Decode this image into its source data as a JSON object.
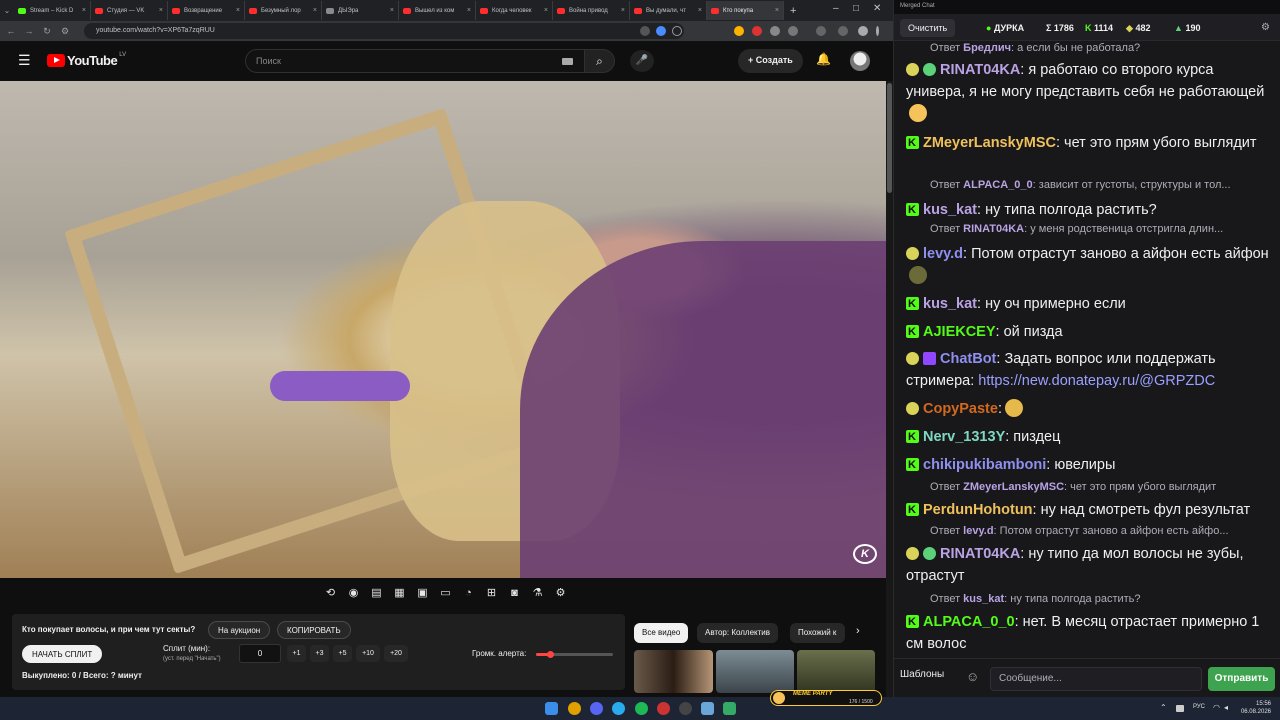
{
  "tabs": [
    {
      "label": "Stream – Kick D",
      "color": "#53fc18"
    },
    {
      "label": "Студия — VK",
      "color": "#ff2d2d"
    },
    {
      "label": "Возвращение",
      "color": "#ff2d2d"
    },
    {
      "label": "Безумный лор",
      "color": "#ff2d2d"
    },
    {
      "label": "ДЫЭра",
      "color": "#8a8a8a"
    },
    {
      "label": "Вышел из ком",
      "color": "#ff2d2d"
    },
    {
      "label": "Когда человек",
      "color": "#ff2d2d"
    },
    {
      "label": "Война привод",
      "color": "#ff2d2d"
    },
    {
      "label": "Вы думали, чт",
      "color": "#ff2d2d"
    },
    {
      "label": "Кто покупа",
      "color": "#ff2d2d",
      "active": true
    }
  ],
  "browser": {
    "url": "youtube.com/watch?v=XP6Ta7zqRUU"
  },
  "youtube": {
    "logo": "YouTube",
    "country": "LV",
    "search_placeholder": "Поиск",
    "create_label": "Создать"
  },
  "video": {
    "watermark": "K"
  },
  "split_panel": {
    "question": "Кто покупает волосы, и при чем тут секты?",
    "auction_btn": "На аукцион",
    "copy_btn": "КОПИРОВАТЬ",
    "start_btn": "НАЧАТЬ СПЛИТ",
    "split_label": "Сплит (мин):",
    "split_hint": "(уст. перед \"Начать\")",
    "split_value": "0",
    "increments": [
      "+1",
      "+3",
      "+5",
      "+10",
      "+20"
    ],
    "alert_label": "Громк. алерта:",
    "alert_volume": 0.18,
    "bought": "Выкуплено: 0 / Всего: ? минут"
  },
  "chips": [
    {
      "label": "Все видео",
      "active": true
    },
    {
      "label": "Автор: Коллектив"
    },
    {
      "label": "Похожий к"
    }
  ],
  "chat": {
    "window_title": "Merged Chat",
    "clear_btn": "Очистить",
    "stats": [
      {
        "label": "ДУРКА",
        "color": "#53fc18"
      },
      {
        "label": "Σ 1786",
        "color": "#efeff1"
      },
      {
        "label": "1114",
        "color": "#53fc18"
      },
      {
        "label": "482",
        "color": "#d9d35a"
      },
      {
        "label": "190",
        "color": "#5bd17a"
      }
    ],
    "messages": [
      {
        "kind": "reply",
        "user": "Бредлич",
        "text": ": а если бы не работала?"
      },
      {
        "kind": "msg",
        "badges": [
          "tw",
          "ok"
        ],
        "user": "RINAT04KA",
        "color": "#b9a3e3",
        "text": ": я работаю со второго курса универа, я не могу представить себя не работающей"
      },
      {
        "kind": "msg",
        "badges": [
          "kick"
        ],
        "user": "ZMeyerLanskyMSC",
        "color": "#f0c05a",
        "text": ": чет это прям убого выглядит"
      },
      {
        "kind": "reply",
        "user": "ALPACA_0_0",
        "text": ": зависит от густоты, структуры и тол..."
      },
      {
        "kind": "msg",
        "badges": [
          "kick"
        ],
        "user": "kus_kat",
        "color": "#b9a3e3",
        "text": ": ну типа полгода растить?"
      },
      {
        "kind": "reply",
        "user": "RINAT04KA",
        "text": ": у меня родственица отстригла длин..."
      },
      {
        "kind": "msg",
        "badges": [
          "tw"
        ],
        "user": "levy.d",
        "color": "#8f8ff0",
        "text": ": Потом отрастут заново а айфон есть айфон"
      },
      {
        "kind": "msg",
        "badges": [
          "kick"
        ],
        "user": "kus_kat",
        "color": "#b9a3e3",
        "text": ": ну оч примерно если"
      },
      {
        "kind": "msg",
        "badges": [
          "kick"
        ],
        "user": "AJIEKCEY",
        "color": "#53fc18",
        "text": ": ой пизда"
      },
      {
        "kind": "msg",
        "badges": [
          "tw",
          "bot"
        ],
        "user": "ChatBot",
        "color": "#8f8ff0",
        "text": ": Задать вопрос или поддержать стримера: ",
        "link": "https://new.donatepay.ru/@GRPZDC"
      },
      {
        "kind": "msg",
        "badges": [
          "tw"
        ],
        "user": "CopyPaste",
        "color": "#d2691e",
        "text": ":"
      },
      {
        "kind": "msg",
        "badges": [
          "kick"
        ],
        "user": "Nerv_1313Y",
        "color": "#7fd9c2",
        "text": ": пиздец"
      },
      {
        "kind": "msg",
        "badges": [
          "kick"
        ],
        "user": "chikipukibamboni",
        "color": "#8f8ff0",
        "text": ": ювелиры"
      },
      {
        "kind": "reply",
        "user": "ZMeyerLanskyMSC",
        "text": ": чет это прям убого выглядит"
      },
      {
        "kind": "msg",
        "badges": [
          "kick"
        ],
        "user": "PerdunHohotun",
        "color": "#f0c05a",
        "text": ": ну над смотреть фул результат"
      },
      {
        "kind": "reply",
        "user": "levy.d",
        "text": ": Потом отрастут заново а айфон есть айфо..."
      },
      {
        "kind": "msg",
        "badges": [
          "tw",
          "ok"
        ],
        "user": "RINAT04KA",
        "color": "#b9a3e3",
        "text": ": ну типо да мол волосы не зубы, отрастут"
      },
      {
        "kind": "reply",
        "user": "kus_kat",
        "text": ": ну типа полгода растить?"
      },
      {
        "kind": "msg",
        "badges": [
          "kick"
        ],
        "user": "ALPACA_0_0",
        "color": "#53fc18",
        "text": ": нет. В месяц отрастает примерно 1 см волос"
      }
    ],
    "templates_btn": "Шаблоны",
    "input_placeholder": "Сообщение...",
    "send_btn": "Отправить"
  },
  "taskbar": {
    "lang": "РУС",
    "time": "15:56",
    "date": "06.08.2026",
    "meme": "MEME PARTY",
    "meme_count": "176 / 1500"
  }
}
